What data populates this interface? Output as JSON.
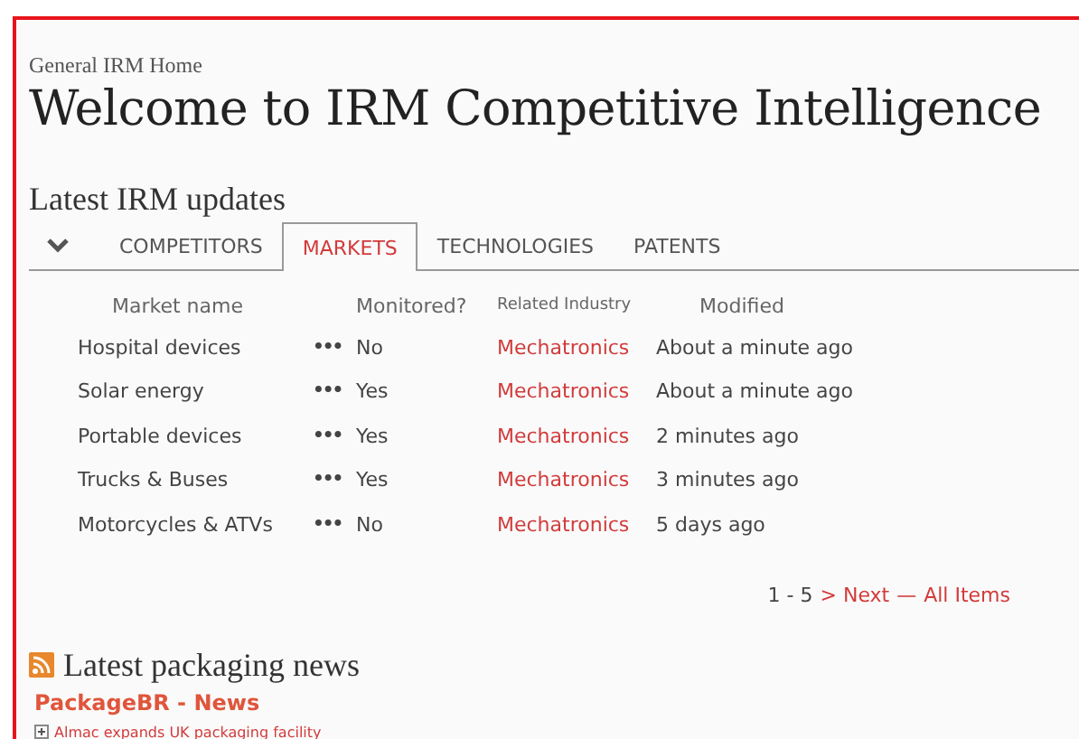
{
  "breadcrumb": "General IRM Home",
  "title": "Welcome to IRM Competitive Intelligence",
  "updates": {
    "heading": "Latest IRM updates",
    "tabs": [
      {
        "label": "COMPETITORS",
        "selected": false
      },
      {
        "label": "MARKETS",
        "selected": true
      },
      {
        "label": "TECHNOLOGIES",
        "selected": false
      },
      {
        "label": "PATENTS",
        "selected": false
      }
    ],
    "columns": [
      "Market name",
      "Monitored?",
      "Related Industry",
      "Modified"
    ],
    "rows": [
      {
        "name": "Hospital devices",
        "menu": "•••",
        "monitored": "No",
        "industry": "Mechatronics",
        "modified": "About a minute ago"
      },
      {
        "name": "Solar energy",
        "menu": "•••",
        "monitored": "Yes",
        "industry": "Mechatronics",
        "modified": "About a minute ago"
      },
      {
        "name": "Portable devices",
        "menu": "•••",
        "monitored": "Yes",
        "industry": "Mechatronics",
        "modified": "2 minutes ago"
      },
      {
        "name": "Trucks & Buses",
        "menu": "•••",
        "monitored": "Yes",
        "industry": "Mechatronics",
        "modified": "3 minutes ago"
      },
      {
        "name": "Motorcycles & ATVs",
        "menu": "•••",
        "monitored": "No",
        "industry": "Mechatronics",
        "modified": "5 days ago"
      }
    ],
    "pager": {
      "range": "1 - 5",
      "next": "> Next",
      "separator": "—",
      "all": "All Items"
    }
  },
  "news": {
    "heading": "Latest packaging news",
    "source": "PackageBR - News",
    "items": [
      "Almac expands UK packaging facility"
    ]
  }
}
